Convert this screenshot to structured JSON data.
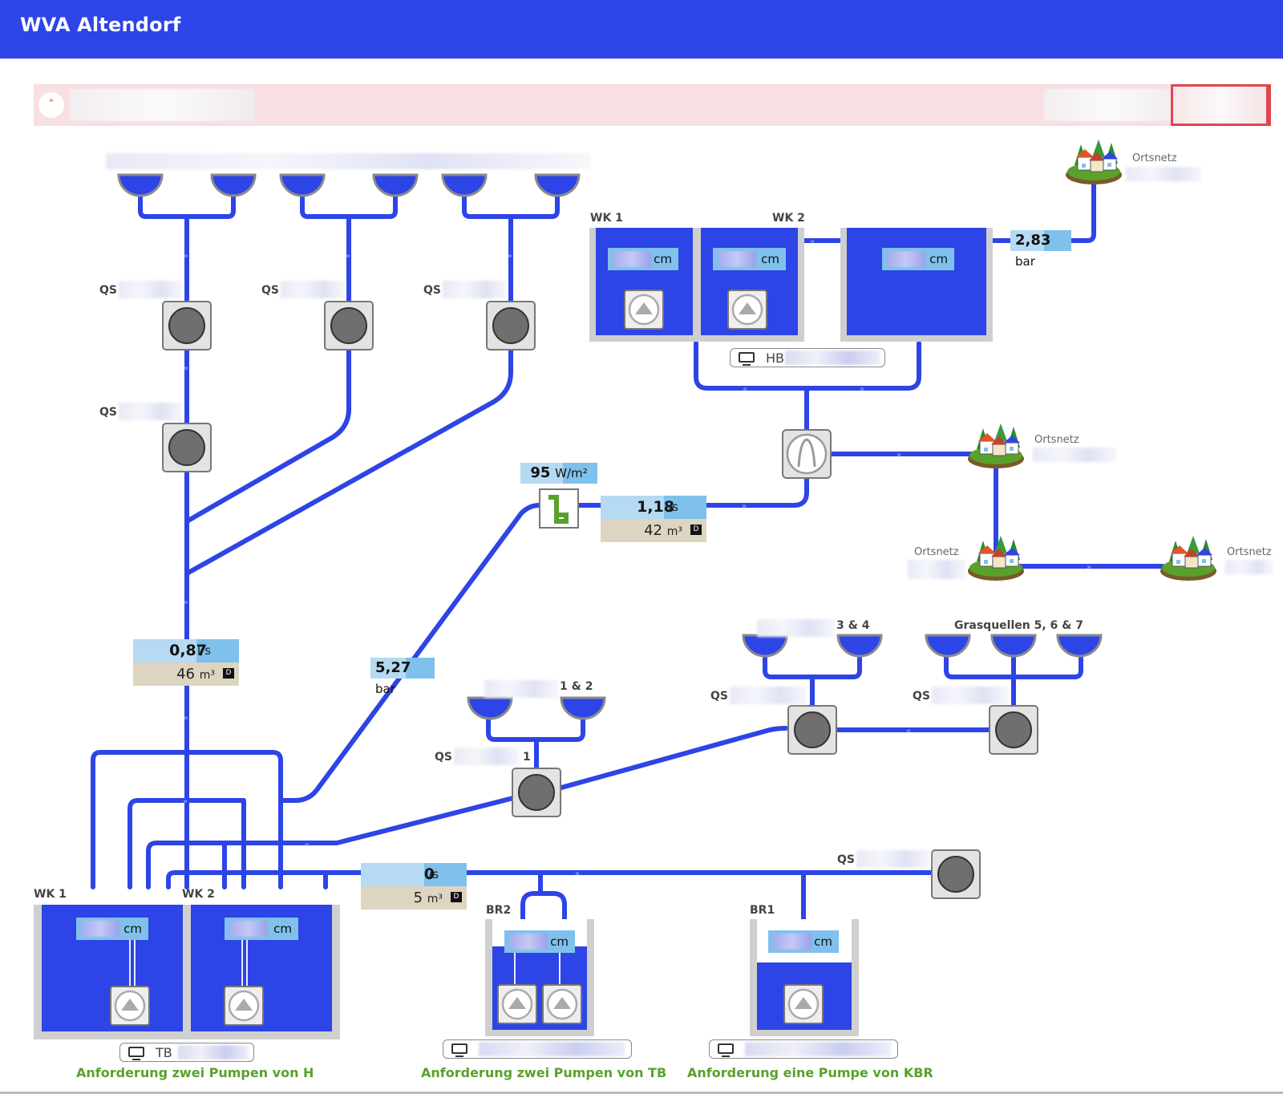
{
  "app": {
    "title": "WVA Altendorf"
  },
  "alarm_bar": {
    "toggle_icon": "chevron-up-icon"
  },
  "labels": {
    "qs": "QS",
    "wk1": "WK 1",
    "wk2": "WK 2",
    "br1": "BR1",
    "br2": "BR2",
    "ortsnetz": "Ortsnetz",
    "quellen_34_suffix": "3 & 4",
    "quellen_12_suffix": "1 & 2",
    "grasquellen": "Grasquellen 5, 6 & 7",
    "qs_suffix_1": "1",
    "level_unit": "cm"
  },
  "measurements": {
    "pressure_hb_out": {
      "value": "2,83",
      "unit": "bar"
    },
    "pressure_main": {
      "value": "5,27",
      "unit": "bar"
    },
    "solar": {
      "value": "95",
      "unit": "W/m²"
    },
    "meter_hb": {
      "flow": "1,18",
      "flow_unit": "l/s",
      "volume": "42",
      "volume_unit": "m³"
    },
    "meter_qs": {
      "flow": "0,87",
      "flow_unit": "l/s",
      "volume": "46",
      "volume_unit": "m³"
    },
    "meter_tb": {
      "flow": "0",
      "flow_unit": "l/s",
      "volume": "5",
      "volume_unit": "m³"
    },
    "day_icon": "D"
  },
  "stations": {
    "hb_label": "HB",
    "tb_label": "TB"
  },
  "requests": {
    "left": "Anforderung zwei Pumpen von H",
    "middle": "Anforderung zwei Pumpen von TB",
    "right": "Anforderung eine Pumpe von KBR"
  }
}
